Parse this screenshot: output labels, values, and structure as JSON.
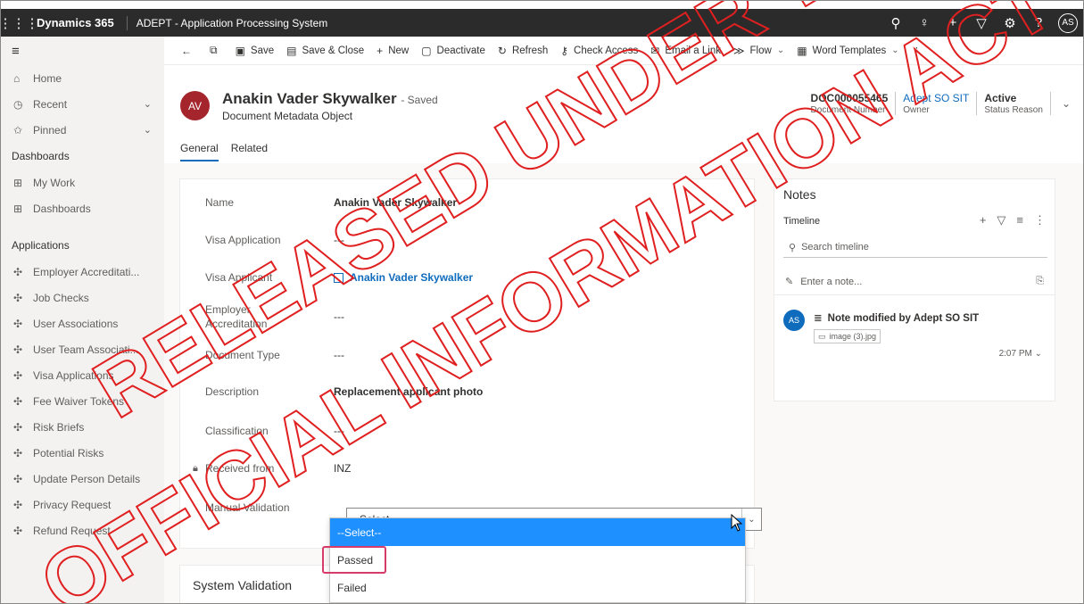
{
  "topbar": {
    "brand": "Dynamics 365",
    "app_name": "ADEPT - Application Processing System",
    "avatar": "AS",
    "icons": [
      "search-icon",
      "lightbulb-icon",
      "plus-icon",
      "filter-icon",
      "gear-icon",
      "help-icon"
    ]
  },
  "sidebar": {
    "items_top": [
      {
        "label": "Home",
        "icon": "home-icon"
      },
      {
        "label": "Recent",
        "icon": "clock-icon"
      },
      {
        "label": "Pinned",
        "icon": "pin-icon"
      }
    ],
    "dashboards_heading": "Dashboards",
    "dashboards": [
      {
        "label": "My Work"
      },
      {
        "label": "Dashboards"
      }
    ],
    "applications_heading": "Applications",
    "applications": [
      {
        "label": "Employer Accreditati..."
      },
      {
        "label": "Job Checks"
      },
      {
        "label": "User Associations"
      },
      {
        "label": "User Team Associati..."
      },
      {
        "label": "Visa Applications"
      },
      {
        "label": "Fee Waiver Tokens"
      },
      {
        "label": "Risk Briefs"
      },
      {
        "label": "Potential Risks"
      },
      {
        "label": "Update Person Details"
      },
      {
        "label": "Privacy Request"
      },
      {
        "label": "Refund Request"
      }
    ]
  },
  "commandbar": {
    "save": "Save",
    "save_close": "Save & Close",
    "new": "New",
    "deactivate": "Deactivate",
    "refresh": "Refresh",
    "check_access": "Check Access",
    "email_link": "Email a Link",
    "flow": "Flow",
    "word_templates": "Word Templates"
  },
  "header": {
    "avatar": "AV",
    "title": "Anakin Vader Skywalker",
    "saved": "- Saved",
    "entity_type": "Document Metadata Object",
    "fields": [
      {
        "value": "DOC000055465",
        "label": "Document Number"
      },
      {
        "value": "Adept SO SIT",
        "label": "Owner"
      },
      {
        "value": "Active",
        "label": "Status Reason"
      }
    ],
    "tabs": [
      "General",
      "Related"
    ]
  },
  "form": {
    "name_label": "Name",
    "name_value": "Anakin Vader Skywalker",
    "visa_app_label": "Visa Application",
    "visa_app_value": "---",
    "visa_applicant_label": "Visa Applicant",
    "visa_applicant_value": "Anakin Vader Skywalker",
    "employer_label": "Employer Accreditation",
    "employer_value": "---",
    "doc_type_label": "Document Type",
    "doc_type_value": "---",
    "description_label": "Description",
    "description_value": "Replacement applicant photo",
    "classification_label": "Classification",
    "classification_value": "---",
    "received_label": "Received from",
    "received_value": "INZ",
    "manual_label": "Manual Validation",
    "manual_value": "--Select--",
    "dropdown_options": [
      "--Select--",
      "Passed",
      "Failed"
    ],
    "system_validation": "System Validation"
  },
  "notes": {
    "title": "Notes",
    "timeline": "Timeline",
    "search_placeholder": "Search timeline",
    "note_placeholder": "Enter a note...",
    "entry_avatar": "AS",
    "entry_text": "Note modified by Adept SO SIT",
    "entry_file": "image (3).jpg",
    "entry_time": "2:07 PM"
  },
  "watermark": {
    "line1": "RELEASED UNDER THE",
    "line2": "OFFICIAL INFORMATION ACT",
    "color": "#e02020"
  }
}
